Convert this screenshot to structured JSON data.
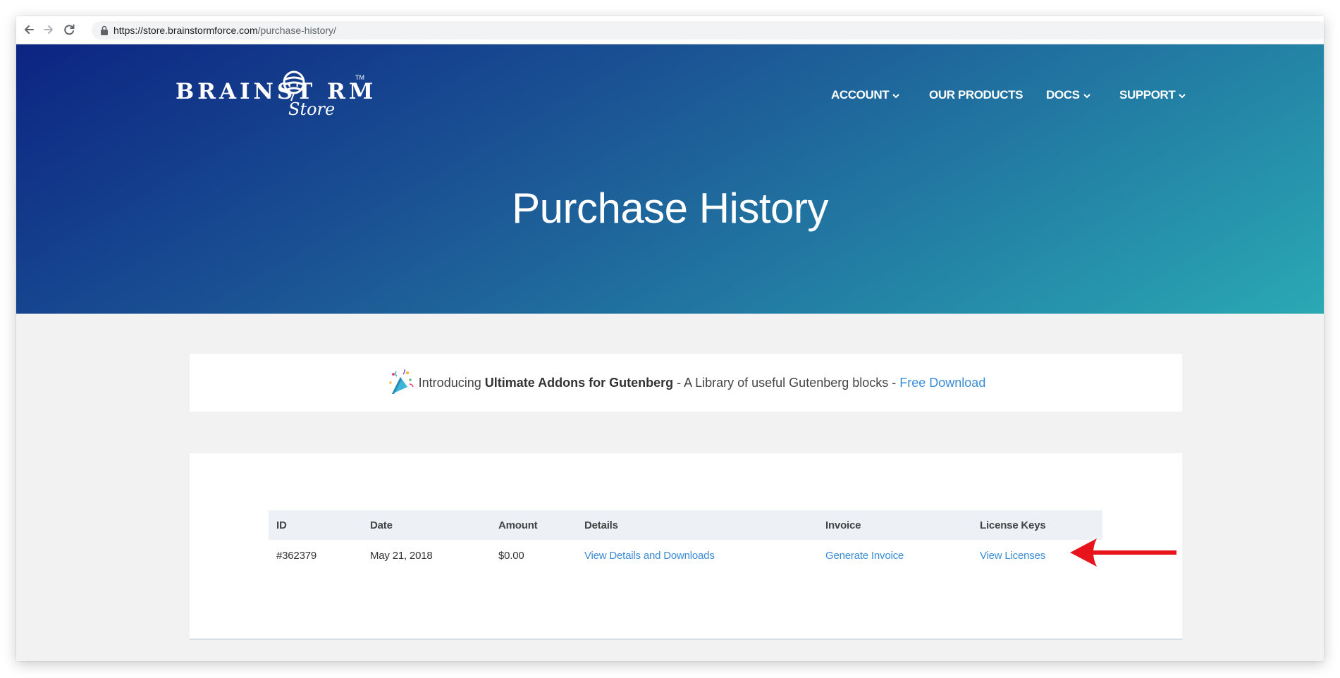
{
  "browser": {
    "url_host": "https://store.brainstormforce.com",
    "url_path": "/purchase-history/"
  },
  "header": {
    "logo_brand": "BRAINST RM",
    "logo_tm": "TM",
    "logo_store": "Store",
    "nav": [
      {
        "label": "ACCOUNT",
        "has_dropdown": true
      },
      {
        "label": "OUR PRODUCTS",
        "has_dropdown": false
      },
      {
        "label": "DOCS",
        "has_dropdown": true
      },
      {
        "label": "SUPPORT",
        "has_dropdown": true
      }
    ],
    "title": "Purchase History"
  },
  "notice": {
    "icon": "party-popper-icon",
    "intro": "Introducing",
    "product": "Ultimate Addons for Gutenberg",
    "description": " - A Library of useful Gutenberg blocks - ",
    "link": "Free Download"
  },
  "table": {
    "columns": [
      "ID",
      "Date",
      "Amount",
      "Details",
      "Invoice",
      "License Keys"
    ],
    "rows": [
      {
        "id": "#362379",
        "date": "May 21, 2018",
        "amount": "$0.00",
        "details": "View Details and Downloads",
        "invoice": "Generate Invoice",
        "license": "View Licenses"
      }
    ]
  },
  "annotation": {
    "icon": "red-arrow-icon",
    "color": "#e8141c"
  },
  "colors": {
    "link": "#3a8bd5",
    "hero_start": "#0c2482",
    "hero_end": "#2aa9b4"
  }
}
